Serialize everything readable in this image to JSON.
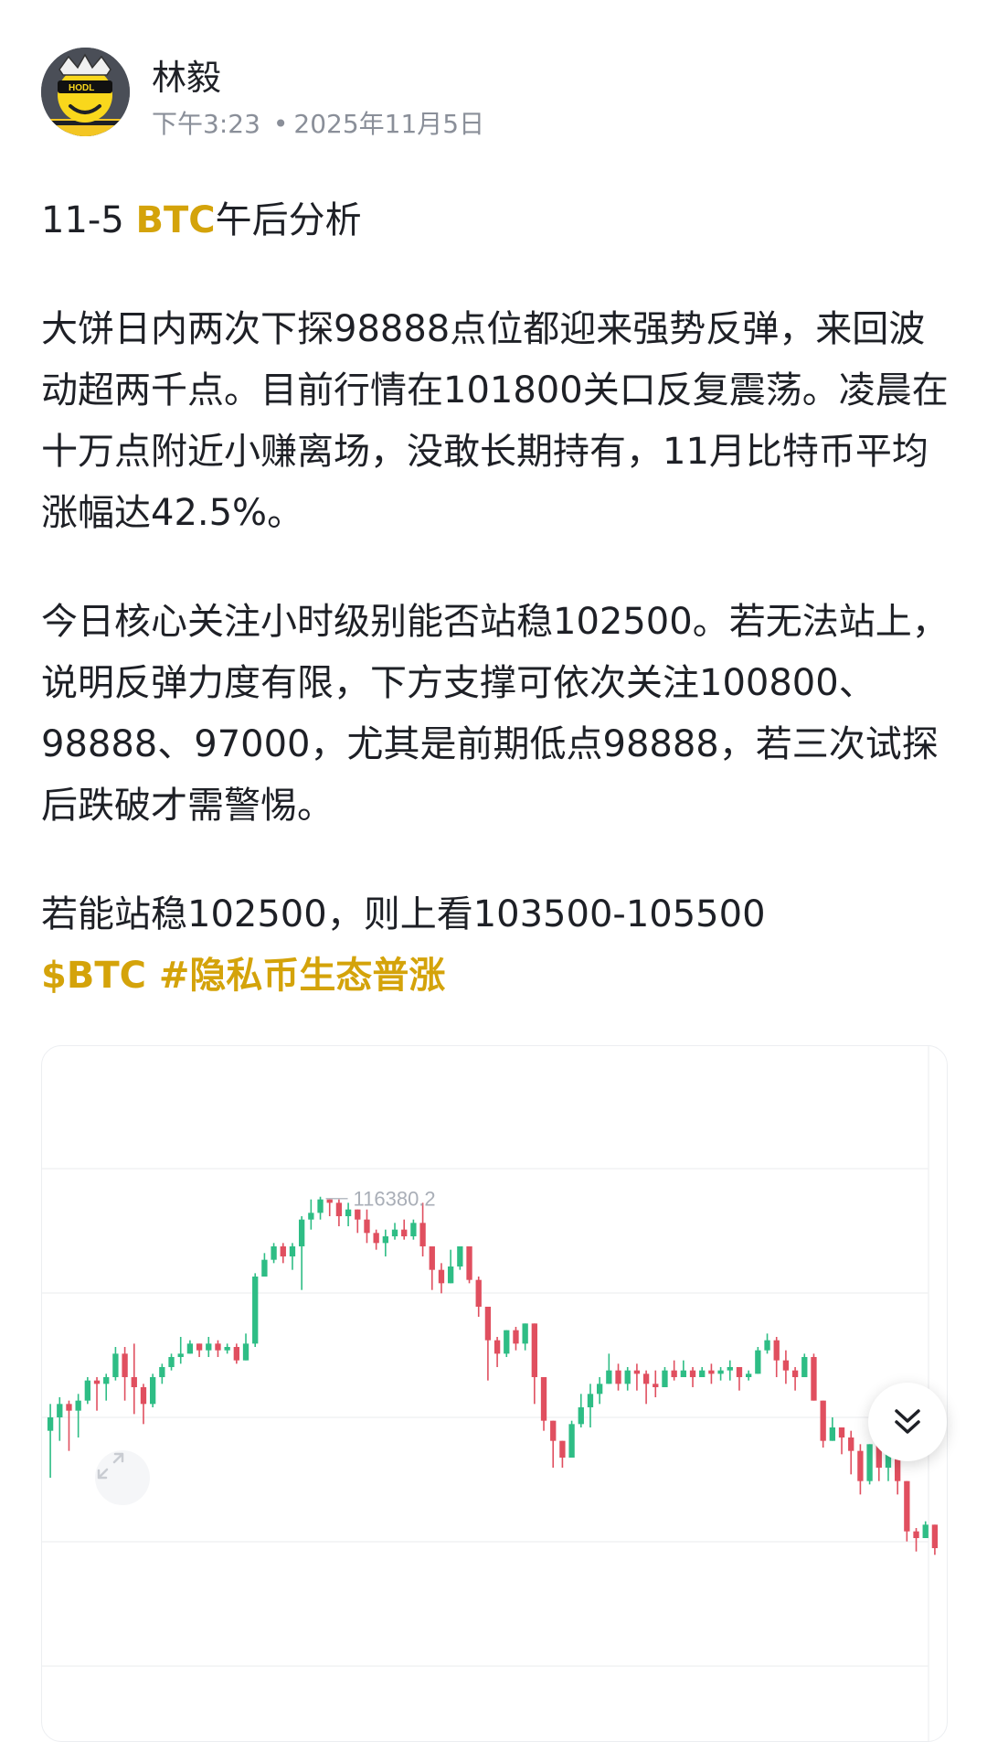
{
  "post": {
    "author": "林毅",
    "time": "下午3:23",
    "separator": "•",
    "date": "2025年11月5日",
    "avatar": {
      "icon": "hodl-emoji-avatar",
      "badge_text": "HODL"
    },
    "title": {
      "prefix": "11-5 ",
      "highlight": "BTC",
      "suffix": "午后分析"
    },
    "paragraphs": [
      "大饼日内两次下探98888点位都迎来强势反弹，来回波动超两千点。目前行情在101800关口反复震荡。凌晨在十万点附近小赚离场，没敢长期持有，11月比特币平均涨幅达42.5%。",
      "今日核心关注小时级别能否站稳102500。若无法站上，说明反弹力度有限，下方支撑可依次关注100800、98888、97000，尤其是前期低点98888，若三次试探后跌破才需警惕。",
      "若能站稳102500，则上看103500-105500"
    ],
    "tags": "$BTC #隐私币生态普涨"
  },
  "colors": {
    "up": "#2ebd85",
    "down": "#e04f5f",
    "accent": "#d4a30a"
  },
  "icons": {
    "expand": "expand-arrows-icon",
    "scroll_down": "double-chevron-down-icon"
  },
  "chart_data": {
    "type": "candlestick",
    "symbol": "BTC",
    "max_label": "116380.2",
    "max_value": 116380.2,
    "ylim": [
      99600,
      117600
    ],
    "candles": [
      [
        109400,
        109800,
        108000,
        110200
      ],
      [
        109800,
        110200,
        109100,
        110400
      ],
      [
        110200,
        110000,
        108800,
        110300
      ],
      [
        110000,
        110300,
        109200,
        110500
      ],
      [
        110300,
        110900,
        110200,
        111000
      ],
      [
        110900,
        110800,
        110000,
        111000
      ],
      [
        110800,
        111000,
        110300,
        111100
      ],
      [
        111000,
        111700,
        110900,
        111900
      ],
      [
        111700,
        111000,
        110300,
        111900
      ],
      [
        111000,
        110700,
        109900,
        112000
      ],
      [
        110700,
        110200,
        109600,
        110800
      ],
      [
        110200,
        111000,
        110100,
        111100
      ],
      [
        111000,
        111300,
        110800,
        111400
      ],
      [
        111300,
        111600,
        111200,
        111700
      ],
      [
        111600,
        111700,
        111400,
        112200
      ],
      [
        111700,
        112000,
        111700,
        112100
      ],
      [
        112000,
        111800,
        111600,
        112000
      ],
      [
        111800,
        112000,
        111600,
        112200
      ],
      [
        112000,
        111800,
        111600,
        112100
      ],
      [
        111800,
        111900,
        111700,
        112000
      ],
      [
        111900,
        111500,
        111400,
        112000
      ],
      [
        111500,
        112000,
        111500,
        112300
      ],
      [
        112000,
        114000,
        111900,
        114100
      ],
      [
        114000,
        114500,
        114000,
        114700
      ],
      [
        114500,
        114900,
        114400,
        115000
      ],
      [
        114900,
        114600,
        114400,
        115000
      ],
      [
        114600,
        114900,
        114200,
        115000
      ],
      [
        114900,
        115700,
        113600,
        115800
      ],
      [
        115700,
        115900,
        115400,
        116300
      ],
      [
        115900,
        116300,
        115700,
        116380.2
      ],
      [
        116300,
        116200,
        115800,
        116300
      ],
      [
        116200,
        115800,
        115500,
        116300
      ],
      [
        115800,
        116000,
        115500,
        116200
      ],
      [
        116000,
        115700,
        115300,
        116000
      ],
      [
        115700,
        115300,
        115000,
        116000
      ],
      [
        115300,
        115000,
        114800,
        115400
      ],
      [
        115000,
        115200,
        114600,
        115400
      ],
      [
        115200,
        115400,
        115100,
        115600
      ],
      [
        115400,
        115200,
        115100,
        115700
      ],
      [
        115200,
        115600,
        115100,
        115700
      ],
      [
        115600,
        114900,
        114600,
        116200
      ],
      [
        114900,
        114200,
        113600,
        114900
      ],
      [
        114200,
        113800,
        113500,
        114400
      ],
      [
        113800,
        114300,
        113800,
        114800
      ],
      [
        114300,
        114900,
        114200,
        114900
      ],
      [
        114900,
        113900,
        113800,
        114400
      ],
      [
        113900,
        113100,
        112800,
        114000
      ],
      [
        113100,
        112100,
        110900,
        113100
      ],
      [
        112100,
        111700,
        111300,
        112200
      ],
      [
        111700,
        112400,
        111600,
        112400
      ],
      [
        112400,
        112000,
        111800,
        112500
      ],
      [
        112000,
        112600,
        111800,
        112600
      ],
      [
        112600,
        111000,
        110200,
        112600
      ],
      [
        111000,
        109700,
        109400,
        111000
      ],
      [
        109700,
        109100,
        108300,
        109700
      ],
      [
        109100,
        108600,
        108300,
        109100
      ],
      [
        108600,
        109600,
        108600,
        109700
      ],
      [
        109600,
        110100,
        109500,
        110500
      ],
      [
        110100,
        110500,
        109500,
        110800
      ],
      [
        110500,
        110800,
        110200,
        111000
      ],
      [
        110800,
        111200,
        110800,
        111700
      ],
      [
        111200,
        110800,
        110600,
        111400
      ],
      [
        110800,
        111200,
        110600,
        111300
      ],
      [
        111200,
        111100,
        110600,
        111400
      ],
      [
        111100,
        110800,
        110200,
        111200
      ],
      [
        110800,
        110700,
        110400,
        111200
      ],
      [
        110700,
        111200,
        110700,
        111300
      ],
      [
        111200,
        111000,
        110900,
        111500
      ],
      [
        111000,
        111200,
        111000,
        111500
      ],
      [
        111200,
        111000,
        110700,
        111300
      ],
      [
        111000,
        111200,
        111000,
        111300
      ],
      [
        111200,
        111100,
        110800,
        111400
      ],
      [
        111100,
        111200,
        110900,
        111300
      ],
      [
        111200,
        111300,
        110900,
        111500
      ],
      [
        111300,
        111000,
        110600,
        111300
      ],
      [
        111000,
        111100,
        110900,
        111200
      ],
      [
        111100,
        111800,
        111100,
        111900
      ],
      [
        111800,
        112100,
        111700,
        112300
      ],
      [
        112100,
        111500,
        111000,
        112200
      ],
      [
        111500,
        111200,
        110800,
        111800
      ],
      [
        111200,
        111000,
        110600,
        111300
      ],
      [
        111000,
        111600,
        111000,
        111700
      ],
      [
        111600,
        110300,
        110300,
        111700
      ],
      [
        110300,
        109100,
        108900,
        110300
      ],
      [
        109100,
        109500,
        109100,
        109800
      ],
      [
        109500,
        109200,
        108700,
        109500
      ],
      [
        109200,
        108800,
        108100,
        109400
      ],
      [
        108800,
        107900,
        107500,
        109000
      ],
      [
        107900,
        109000,
        107800,
        109000
      ],
      [
        109000,
        108300,
        107900,
        109100
      ],
      [
        108300,
        108900,
        107900,
        109000
      ],
      [
        108900,
        107900,
        107500,
        108900
      ],
      [
        107900,
        106400,
        106100,
        107900
      ],
      [
        106400,
        106200,
        105800,
        106500
      ],
      [
        106200,
        106600,
        106200,
        106700
      ],
      [
        106600,
        105900,
        105700,
        106600
      ]
    ]
  }
}
